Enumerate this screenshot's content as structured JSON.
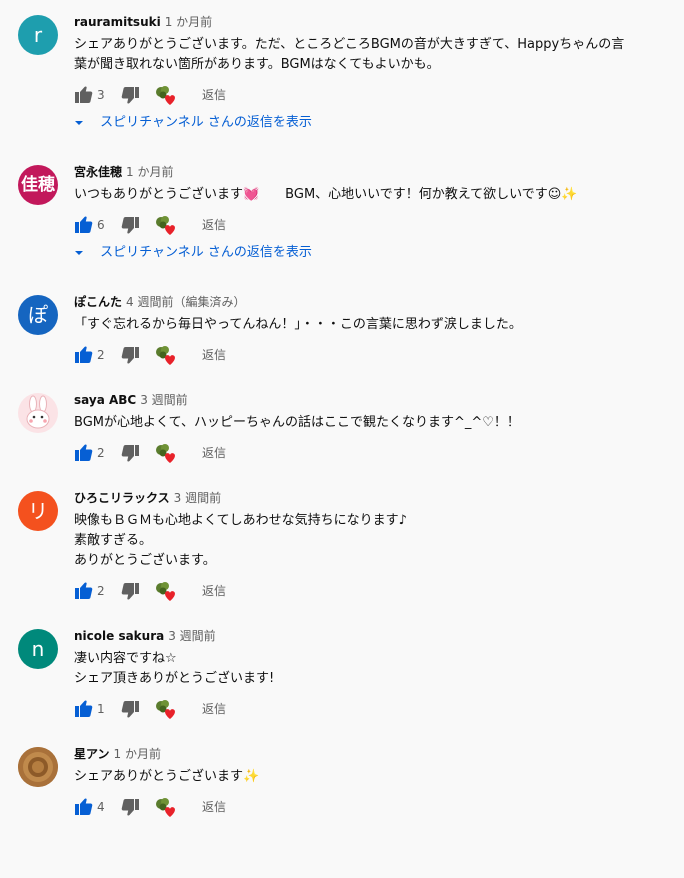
{
  "comments": [
    {
      "author": "rauramitsuki",
      "time": "1 か月前",
      "avatar_text": "r",
      "avatar_color": "#1e9eae",
      "text": "シェアありがとうございます。ただ、ところどころBGMの音が大きすぎて、Happyちゃんの言\n葉が聞き取れない箇所があります。BGMはなくてもよいかも。",
      "likes": "3",
      "liked": false,
      "reply_label": "返信",
      "replies_label": "スピリチャンネル さんの返信を表示"
    },
    {
      "author": "宮永佳穂",
      "time": "1 か月前",
      "avatar_text": "佳穂",
      "avatar_color": "#c2185b",
      "text": "いつもありがとうございます💓　　BGM、心地いいです！何か教えて欲しいです☺✨",
      "likes": "6",
      "liked": true,
      "reply_label": "返信",
      "replies_label": "スピリチャンネル さんの返信を表示"
    },
    {
      "author": "ぽこんた",
      "time": "4 週間前（編集済み）",
      "avatar_text": "ぽ",
      "avatar_color": "#1565c0",
      "text": "「すぐ忘れるから毎日やってんねん！」・・・この言葉に思わず涙しました。",
      "likes": "2",
      "liked": true,
      "reply_label": "返信"
    },
    {
      "author": "saya ABC",
      "time": "3 週間前",
      "avatar_text": "",
      "avatar_color": "#fbe3e6",
      "text": "BGMが心地よくて、ハッピーちゃんの話はここで観たくなります^_^♡！！",
      "likes": "2",
      "liked": true,
      "reply_label": "返信"
    },
    {
      "author": "ひろこリラックス",
      "time": "3 週間前",
      "avatar_text": "リ",
      "avatar_color": "#f4511e",
      "text": "映像もＢＧＭも心地よくてしあわせな気持ちになります♪\n素敵すぎる。\nありがとうございます。",
      "likes": "2",
      "liked": true,
      "reply_label": "返信"
    },
    {
      "author": "nicole sakura",
      "time": "3 週間前",
      "avatar_text": "n",
      "avatar_color": "#00897b",
      "text": "凄い内容ですね☆\nシェア頂きありがとうございます!",
      "likes": "1",
      "liked": true,
      "reply_label": "返信"
    },
    {
      "author": "星アン",
      "time": "1 か月前",
      "avatar_text": "",
      "avatar_color": "#a9713a",
      "text": "シェアありがとうございます✨",
      "likes": "4",
      "liked": true,
      "reply_label": "返信"
    }
  ]
}
